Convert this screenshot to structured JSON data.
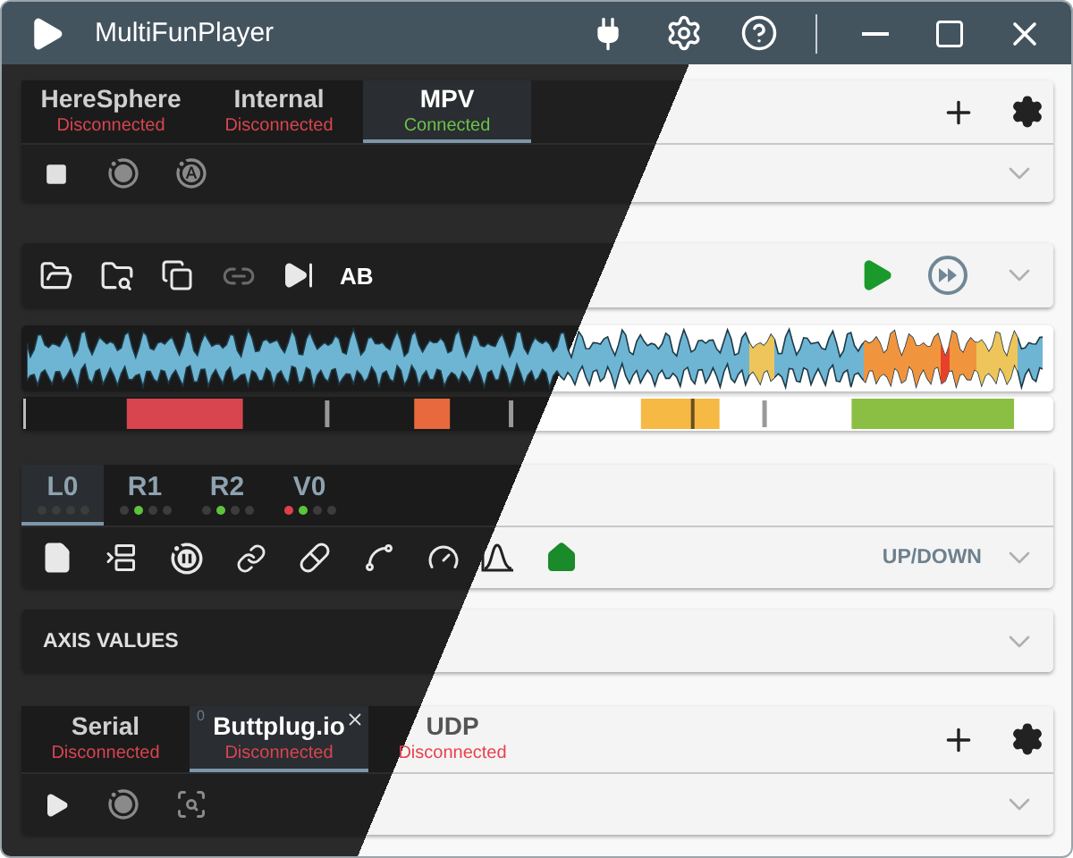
{
  "window": {
    "title": "MultiFunPlayer"
  },
  "video_panel": {
    "tabs": [
      {
        "label": "HereSphere",
        "status": "Disconnected",
        "color": "#d9454f",
        "selected": false
      },
      {
        "label": "Internal",
        "status": "Disconnected",
        "color": "#d9454f",
        "selected": false
      },
      {
        "label": "MPV",
        "status": "Connected",
        "color": "#6cc24a",
        "selected": true
      }
    ]
  },
  "script_panel": {
    "link_disabled": true,
    "ab_label": "AB"
  },
  "axis_panel": {
    "tabs": [
      {
        "label": "L0",
        "selected": true,
        "dots": [
          {
            "color": "#3c3c3c"
          },
          {
            "color": "#3c3c3c"
          },
          {
            "color": "#3c3c3c"
          },
          {
            "color": "#3c3c3c"
          }
        ]
      },
      {
        "label": "R1",
        "selected": false,
        "dots": [
          {
            "color": "#3c3c3c"
          },
          {
            "color": "#5cc43c"
          },
          {
            "color": "#3c3c3c"
          },
          {
            "color": "#3c3c3c"
          }
        ]
      },
      {
        "label": "R2",
        "selected": false,
        "dots": [
          {
            "color": "#3c3c3c"
          },
          {
            "color": "#5cc43c"
          },
          {
            "color": "#3c3c3c"
          },
          {
            "color": "#3c3c3c"
          }
        ]
      },
      {
        "label": "V0",
        "selected": false,
        "dots": [
          {
            "color": "#e0404a"
          },
          {
            "color": "#5cc43c"
          },
          {
            "color": "#3c3c3c"
          },
          {
            "color": "#3c3c3c"
          }
        ]
      }
    ],
    "mode": "UP/DOWN"
  },
  "axis_values": {
    "title": "AXIS VALUES"
  },
  "output_panel": {
    "tabs": [
      {
        "label": "Serial",
        "status": "Disconnected",
        "color": "#d9454f",
        "selected": false,
        "closable": false
      },
      {
        "label": "Buttplug.io",
        "badge": "0",
        "status": "Disconnected",
        "color": "#d9454f",
        "selected": true,
        "closable": true
      },
      {
        "label": "UDP",
        "status": "Disconnected",
        "color": "#e8404c",
        "selected": false,
        "closable": false
      }
    ]
  }
}
